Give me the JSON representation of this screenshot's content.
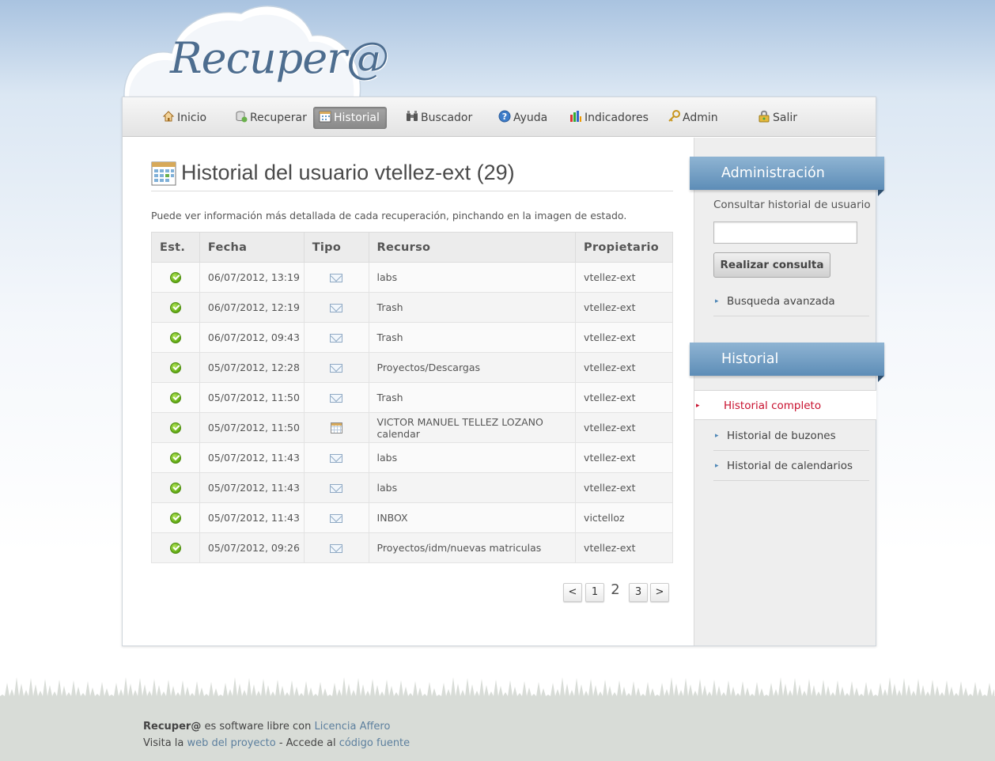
{
  "logo": {
    "text": "Recuper@"
  },
  "nav": {
    "items": [
      {
        "label": "Inicio",
        "icon": "home-icon"
      },
      {
        "label": "Recuperar",
        "icon": "database-icon"
      },
      {
        "label": "Historial",
        "icon": "calendar-icon",
        "active": true
      },
      {
        "label": "Buscador",
        "icon": "binoculars-icon"
      },
      {
        "label": "Ayuda",
        "icon": "help-icon"
      },
      {
        "label": "Indicadores",
        "icon": "bar-chart-icon"
      },
      {
        "label": "Admin",
        "icon": "key-icon"
      },
      {
        "label": "Salir",
        "icon": "lock-icon"
      }
    ]
  },
  "main": {
    "title": "Historial del usuario vtellez-ext (29)",
    "description": "Puede ver información más detallada de cada recuperación, pinchando en la imagen de estado.",
    "table": {
      "headers": [
        "Est.",
        "Fecha",
        "Tipo",
        "Recurso",
        "Propietario"
      ],
      "rows": [
        {
          "status": "ok",
          "fecha": "06/07/2012, 13:19",
          "tipo": "mail",
          "recurso": "labs",
          "propietario": "vtellez-ext"
        },
        {
          "status": "ok",
          "fecha": "06/07/2012, 12:19",
          "tipo": "mail",
          "recurso": "Trash",
          "propietario": "vtellez-ext"
        },
        {
          "status": "ok",
          "fecha": "06/07/2012, 09:43",
          "tipo": "mail",
          "recurso": "Trash",
          "propietario": "vtellez-ext"
        },
        {
          "status": "ok",
          "fecha": "05/07/2012, 12:28",
          "tipo": "mail",
          "recurso": "Proyectos/Descargas",
          "propietario": "vtellez-ext"
        },
        {
          "status": "ok",
          "fecha": "05/07/2012, 11:50",
          "tipo": "mail",
          "recurso": "Trash",
          "propietario": "vtellez-ext"
        },
        {
          "status": "ok",
          "fecha": "05/07/2012, 11:50",
          "tipo": "calendar",
          "recurso": "VICTOR MANUEL TELLEZ LOZANO calendar",
          "propietario": "vtellez-ext"
        },
        {
          "status": "ok",
          "fecha": "05/07/2012, 11:43",
          "tipo": "mail",
          "recurso": "labs",
          "propietario": "vtellez-ext"
        },
        {
          "status": "ok",
          "fecha": "05/07/2012, 11:43",
          "tipo": "mail",
          "recurso": "labs",
          "propietario": "vtellez-ext"
        },
        {
          "status": "ok",
          "fecha": "05/07/2012, 11:43",
          "tipo": "mail",
          "recurso": "INBOX",
          "propietario": "victelloz"
        },
        {
          "status": "ok",
          "fecha": "05/07/2012, 09:26",
          "tipo": "mail",
          "recurso": "Proyectos/idm/nuevas matriculas",
          "propietario": "vtellez-ext"
        }
      ]
    },
    "pagination": {
      "prev": "<",
      "pages": [
        "1",
        "2",
        "3"
      ],
      "current": "2",
      "next": ">"
    }
  },
  "sidebar": {
    "admin": {
      "heading": "Administración",
      "label": "Consultar historial de usuario",
      "input_value": "",
      "button": "Realizar consulta",
      "link": "Busqueda avanzada"
    },
    "historial": {
      "heading": "Historial",
      "links": [
        "Historial completo",
        "Historial de buzones",
        "Historial de calendarios"
      ]
    }
  },
  "footer": {
    "line1": {
      "brand": "Recuper@",
      "text": " es software libre con ",
      "link": "Licencia Affero"
    },
    "line2": {
      "text1": "Visita la ",
      "link1": "web del proyecto",
      "text2": " - Accede al ",
      "link2": "código fuente"
    }
  },
  "colors": {
    "accent": "#5d8db7",
    "active_link": "#c8102e",
    "footer_link": "#5c7f9e"
  }
}
